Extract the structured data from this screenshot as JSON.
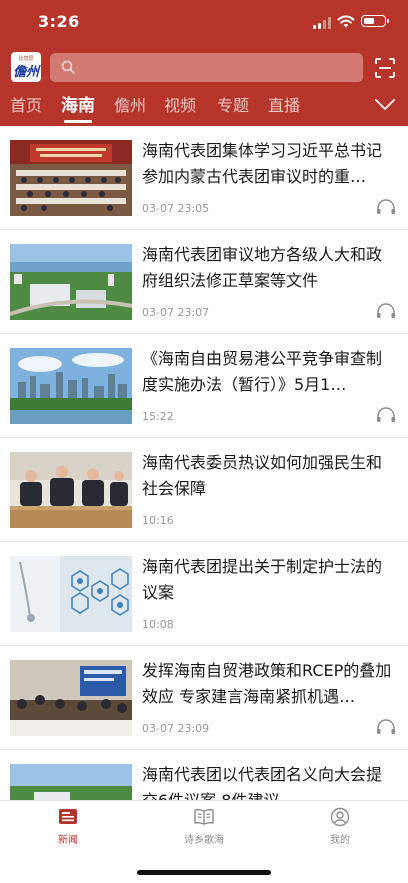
{
  "status_bar": {
    "time": "3:26"
  },
  "header": {
    "logo_top_text": "比觉早",
    "logo_main_text": "儋州",
    "search": {
      "placeholder": ""
    }
  },
  "tabs": [
    {
      "label": "首页",
      "active": false
    },
    {
      "label": "海南",
      "active": true
    },
    {
      "label": "儋州",
      "active": false
    },
    {
      "label": "视频",
      "active": false
    },
    {
      "label": "专题",
      "active": false
    },
    {
      "label": "直播",
      "active": false
    }
  ],
  "news": [
    {
      "title": "海南代表团集体学习习近平总书记参加内蒙古代表团审议时的重…",
      "time": "03-07 23:05",
      "has_audio": true,
      "thumb": "meeting-hall"
    },
    {
      "title": "海南代表团审议地方各级人大和政府组织法修正草案等文件",
      "time": "03-07 23:07",
      "has_audio": true,
      "thumb": "aerial-city"
    },
    {
      "title": "《海南自由贸易港公平竞争审查制度实施办法（暂行）》5月1…",
      "time": "15:22",
      "has_audio": true,
      "thumb": "skyline"
    },
    {
      "title": "海南代表委员热议如何加强民生和社会保障",
      "time": "10:16",
      "has_audio": false,
      "thumb": "delegates"
    },
    {
      "title": "海南代表团提出关于制定护士法的议案",
      "time": "10:08",
      "has_audio": false,
      "thumb": "medical"
    },
    {
      "title": "发挥海南自贸港政策和RCEP的叠加效应 专家建言海南紧抓机遇…",
      "time": "03-07 23:09",
      "has_audio": true,
      "thumb": "conference"
    },
    {
      "title": "海南代表团以代表团名义向大会提交6件议案 8件建议",
      "time": "",
      "has_audio": false,
      "thumb": "aerial-city"
    }
  ],
  "bottom_nav": [
    {
      "label": "新闻",
      "icon": "news-icon",
      "active": true
    },
    {
      "label": "诗乡歌海",
      "icon": "book-icon",
      "active": false
    },
    {
      "label": "我的",
      "icon": "user-icon",
      "active": false
    }
  ],
  "colors": {
    "brand_red": "#b5352a",
    "text": "#1a1a1a",
    "muted": "#9a9a9a"
  }
}
